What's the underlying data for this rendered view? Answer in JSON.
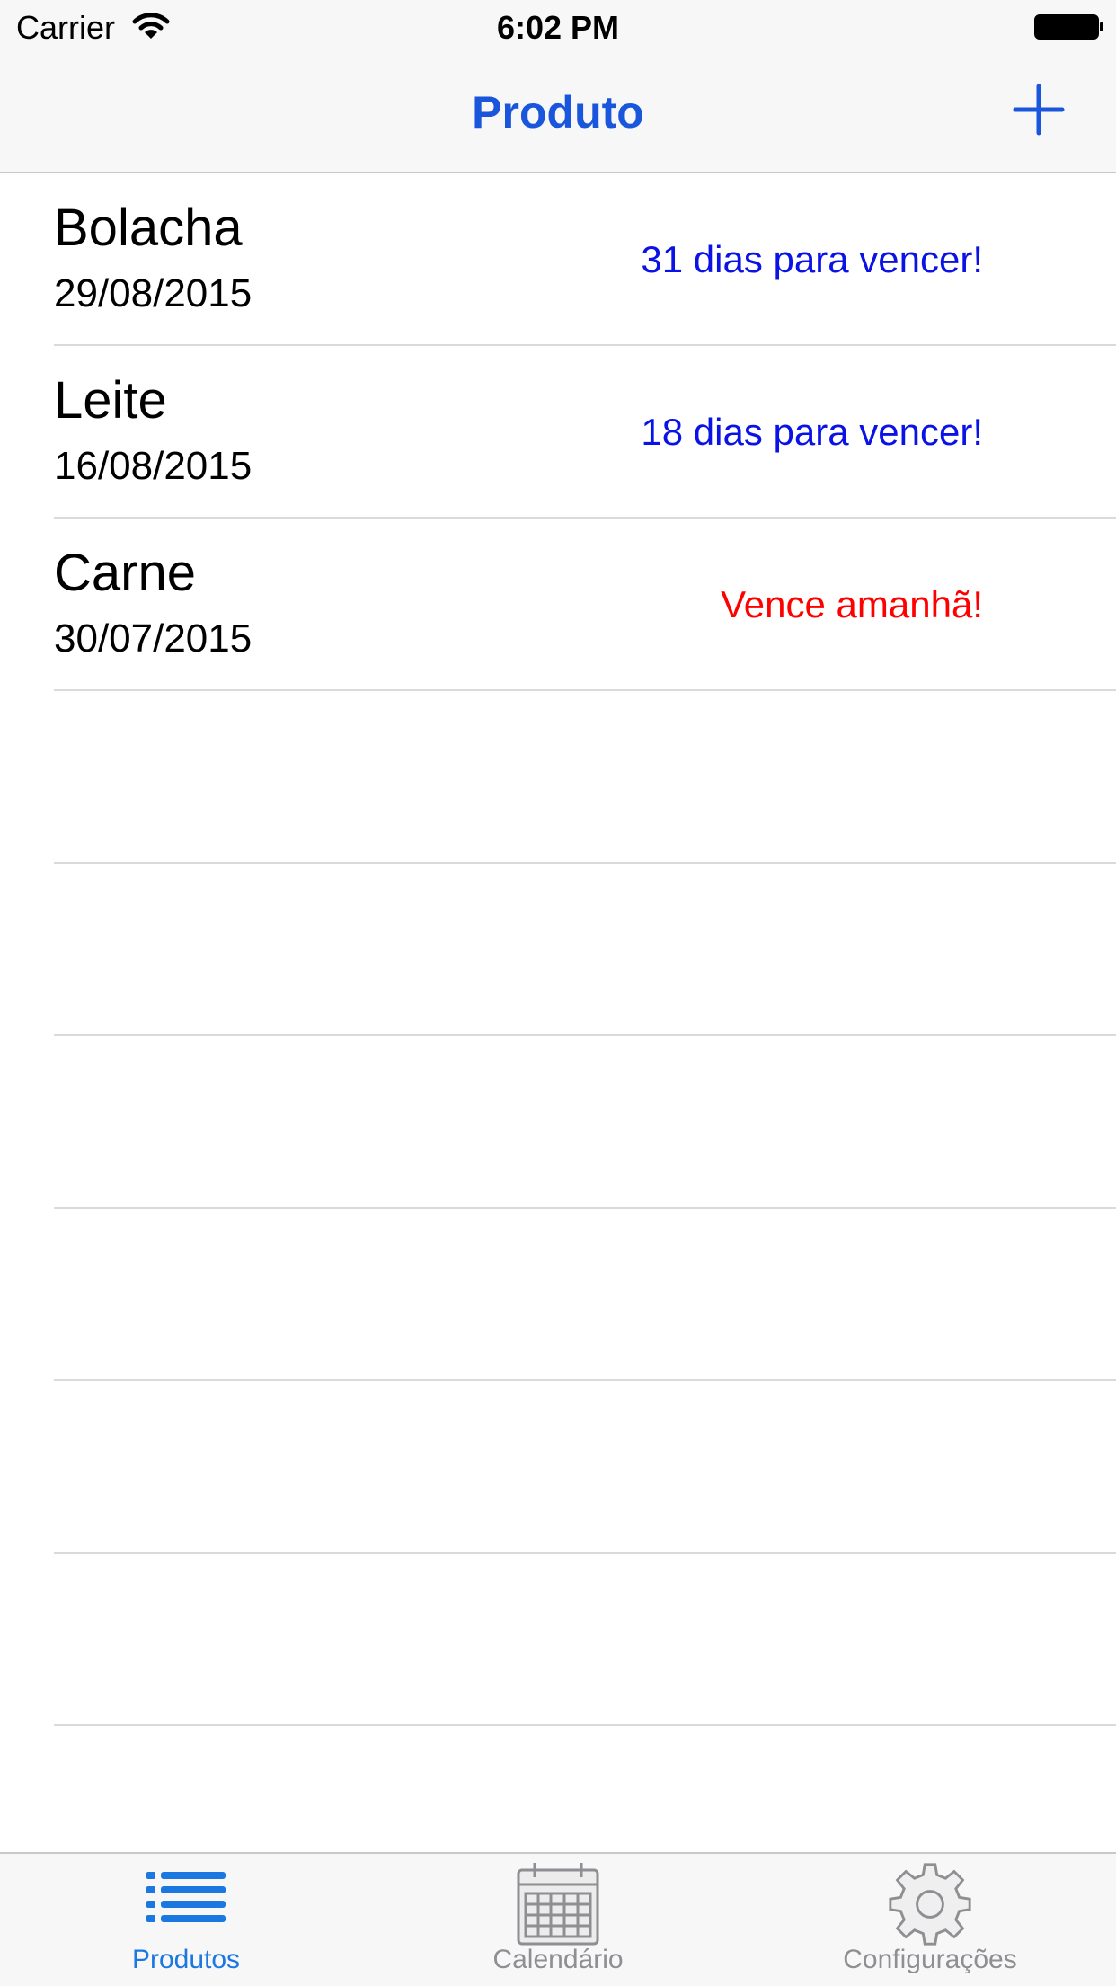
{
  "status_bar": {
    "carrier": "Carrier",
    "time": "6:02 PM"
  },
  "nav": {
    "title": "Produto",
    "add_icon": "plus-icon"
  },
  "products": [
    {
      "name": "Bolacha",
      "date": "29/08/2015",
      "status": "31 dias para vencer!",
      "status_color": "#0a12e6"
    },
    {
      "name": "Leite",
      "date": "16/08/2015",
      "status": "18 dias para vencer!",
      "status_color": "#0a12e6"
    },
    {
      "name": "Carne",
      "date": "30/07/2015",
      "status": "Vence amanhã!",
      "status_color": "#ff0000"
    }
  ],
  "empty_rows": 6,
  "tabs": [
    {
      "label": "Produtos",
      "icon": "list-icon",
      "active": true
    },
    {
      "label": "Calendário",
      "icon": "calendar-icon",
      "active": false
    },
    {
      "label": "Configurações",
      "icon": "gear-icon",
      "active": false
    }
  ],
  "colors": {
    "accent": "#1a56db",
    "tab_active": "#1a78e0",
    "tab_inactive": "#8e8e93"
  }
}
